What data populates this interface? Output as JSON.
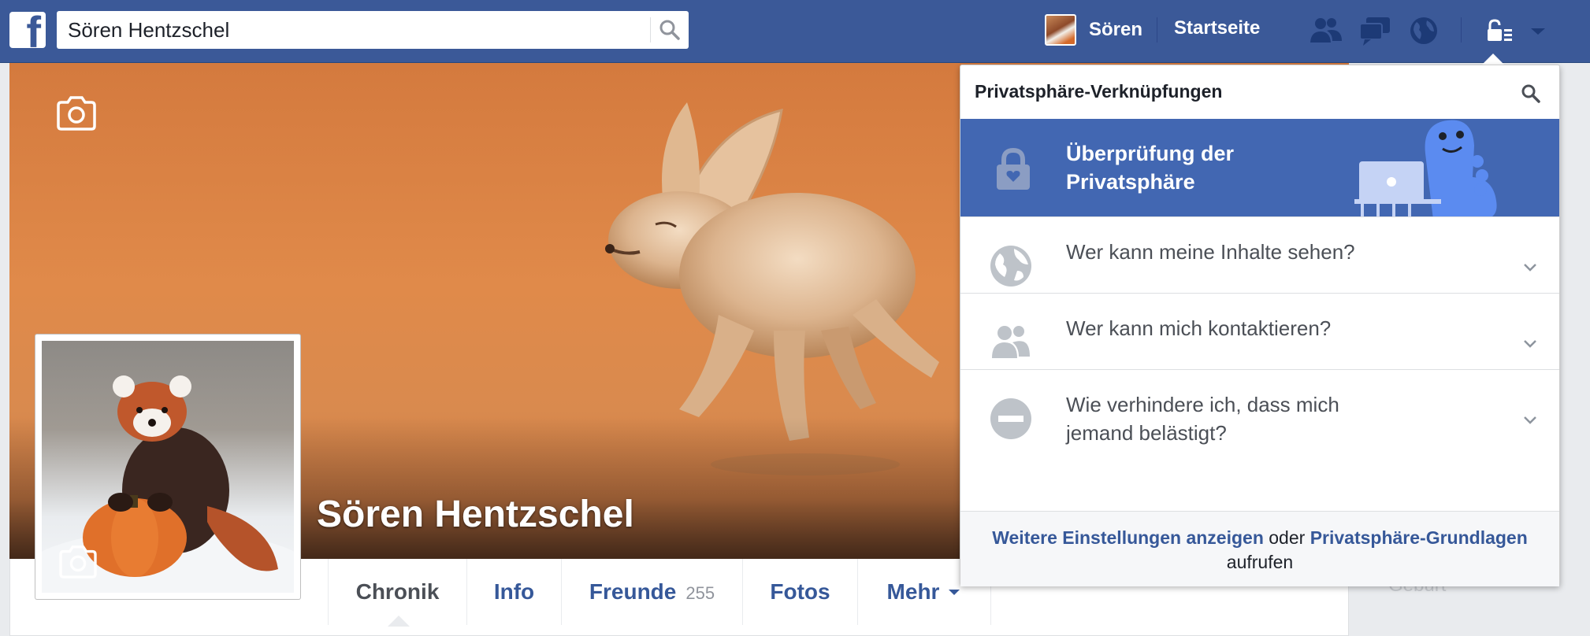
{
  "topbar": {
    "logo_letter": "f",
    "search_value": "Sören Hentzschel",
    "user_name": "Sören",
    "home_label": "Startseite"
  },
  "profile": {
    "name": "Sören Hentzschel"
  },
  "tabs": [
    {
      "label": "Chronik",
      "active": true
    },
    {
      "label": "Info"
    },
    {
      "label": "Freunde",
      "count": "255"
    },
    {
      "label": "Fotos"
    },
    {
      "label": "Mehr"
    }
  ],
  "side": {
    "text": "Geburt"
  },
  "privacy": {
    "title": "Privatsphäre-Verknüpfungen",
    "checkup_label": "Überprüfung der Privatsphäre",
    "items": [
      {
        "label": "Wer kann meine Inhalte sehen?",
        "icon": "globe-icon"
      },
      {
        "label": "Wer kann mich kontaktieren?",
        "icon": "people-icon"
      },
      {
        "label": "Wie verhindere ich, dass mich jemand belästigt?",
        "icon": "block-icon"
      }
    ],
    "footer": {
      "link1": "Weitere Einstellungen anzeigen",
      "middle": "oder",
      "link2": "Privatsphäre-Grundlagen",
      "end": "aufrufen"
    }
  },
  "colors": {
    "brand": "#3b5998",
    "link": "#365899",
    "checkup_bg": "#4267b2"
  }
}
